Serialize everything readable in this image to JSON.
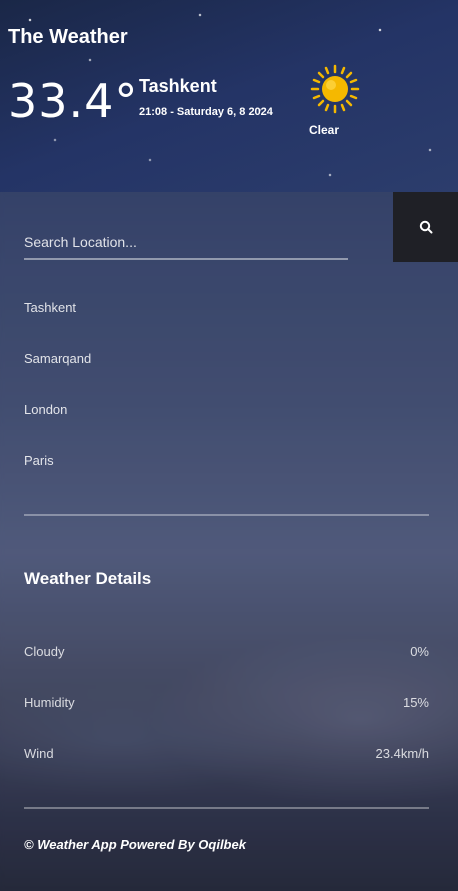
{
  "header": {
    "app_title": "The Weather",
    "temperature": "33.4°",
    "city": "Tashkent",
    "datetime": "21:08 - Saturday 6, 8 2024",
    "condition": "Clear",
    "condition_icon": "sun-icon"
  },
  "search": {
    "placeholder": "Search Location...",
    "value": "",
    "button_icon": "search-icon"
  },
  "locations": [
    "Tashkent",
    "Samarqand",
    "London",
    "Paris"
  ],
  "details": {
    "title": "Weather Details",
    "rows": [
      {
        "label": "Cloudy",
        "value": "0%"
      },
      {
        "label": "Humidity",
        "value": "15%"
      },
      {
        "label": "Wind",
        "value": "23.4km/h"
      }
    ]
  },
  "footer": {
    "text": "© Weather App Powered By Oqilbek"
  },
  "colors": {
    "sun": "#f5b800",
    "search_button_bg": "#1f2026"
  }
}
